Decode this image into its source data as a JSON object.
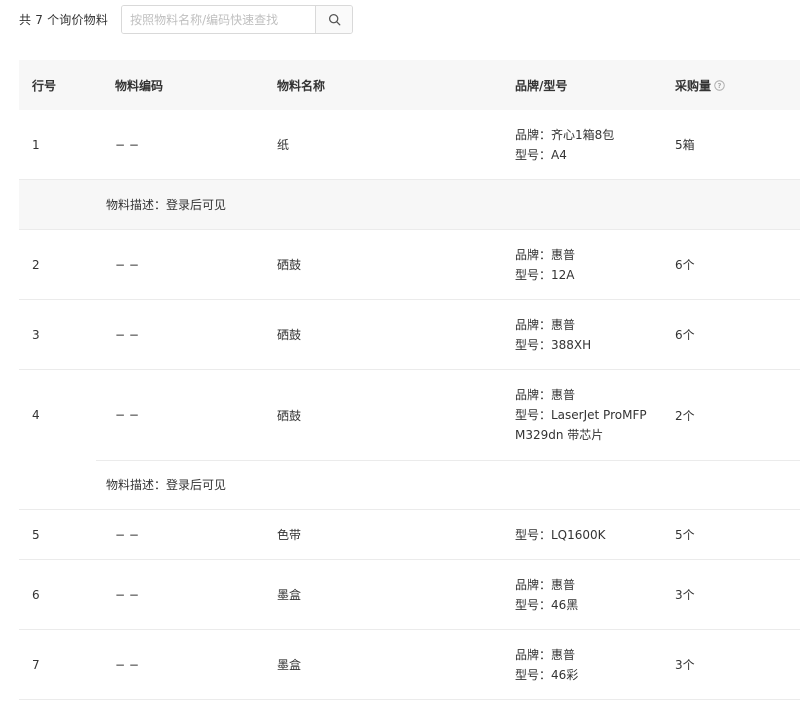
{
  "toolbar": {
    "count_label": "共 7 个询价物料",
    "search_placeholder": "按照物料名称/编码快速查找",
    "search_icon": "search-icon"
  },
  "table": {
    "headers": {
      "row_no": "行号",
      "code": "物料编码",
      "name": "物料名称",
      "brand_model": "品牌/型号",
      "quantity": "采购量",
      "quantity_help_icon": "question-circle-icon"
    },
    "rows": [
      {
        "no": "1",
        "code": "− −",
        "name": "纸",
        "brand": "品牌：齐心1箱8包",
        "model": "型号：A4",
        "qty": "5箱"
      },
      {
        "no": "2",
        "code": "− −",
        "name": "硒鼓",
        "brand": "品牌：惠普",
        "model": "型号：12A",
        "qty": "6个"
      },
      {
        "no": "3",
        "code": "− −",
        "name": "硒鼓",
        "brand": "品牌：惠普",
        "model": "型号：388XH",
        "qty": "6个"
      },
      {
        "no": "4",
        "code": "− −",
        "name": "硒鼓",
        "brand": "品牌：惠普",
        "model": "型号：LaserJet ProMFP M329dn 带芯片",
        "qty": "2个"
      },
      {
        "no": "5",
        "code": "− −",
        "name": "色带",
        "model": "型号：LQ1600K",
        "qty": "5个"
      },
      {
        "no": "6",
        "code": "− −",
        "name": "墨盒",
        "brand": "品牌：惠普",
        "model": "型号：46黑",
        "qty": "3个"
      },
      {
        "no": "7",
        "code": "− −",
        "name": "墨盒",
        "brand": "品牌：惠普",
        "model": "型号：46彩",
        "qty": "3个"
      }
    ],
    "descriptions": {
      "after_row_1": "物料描述：登录后可见",
      "after_row_4": "物料描述：登录后可见"
    }
  }
}
